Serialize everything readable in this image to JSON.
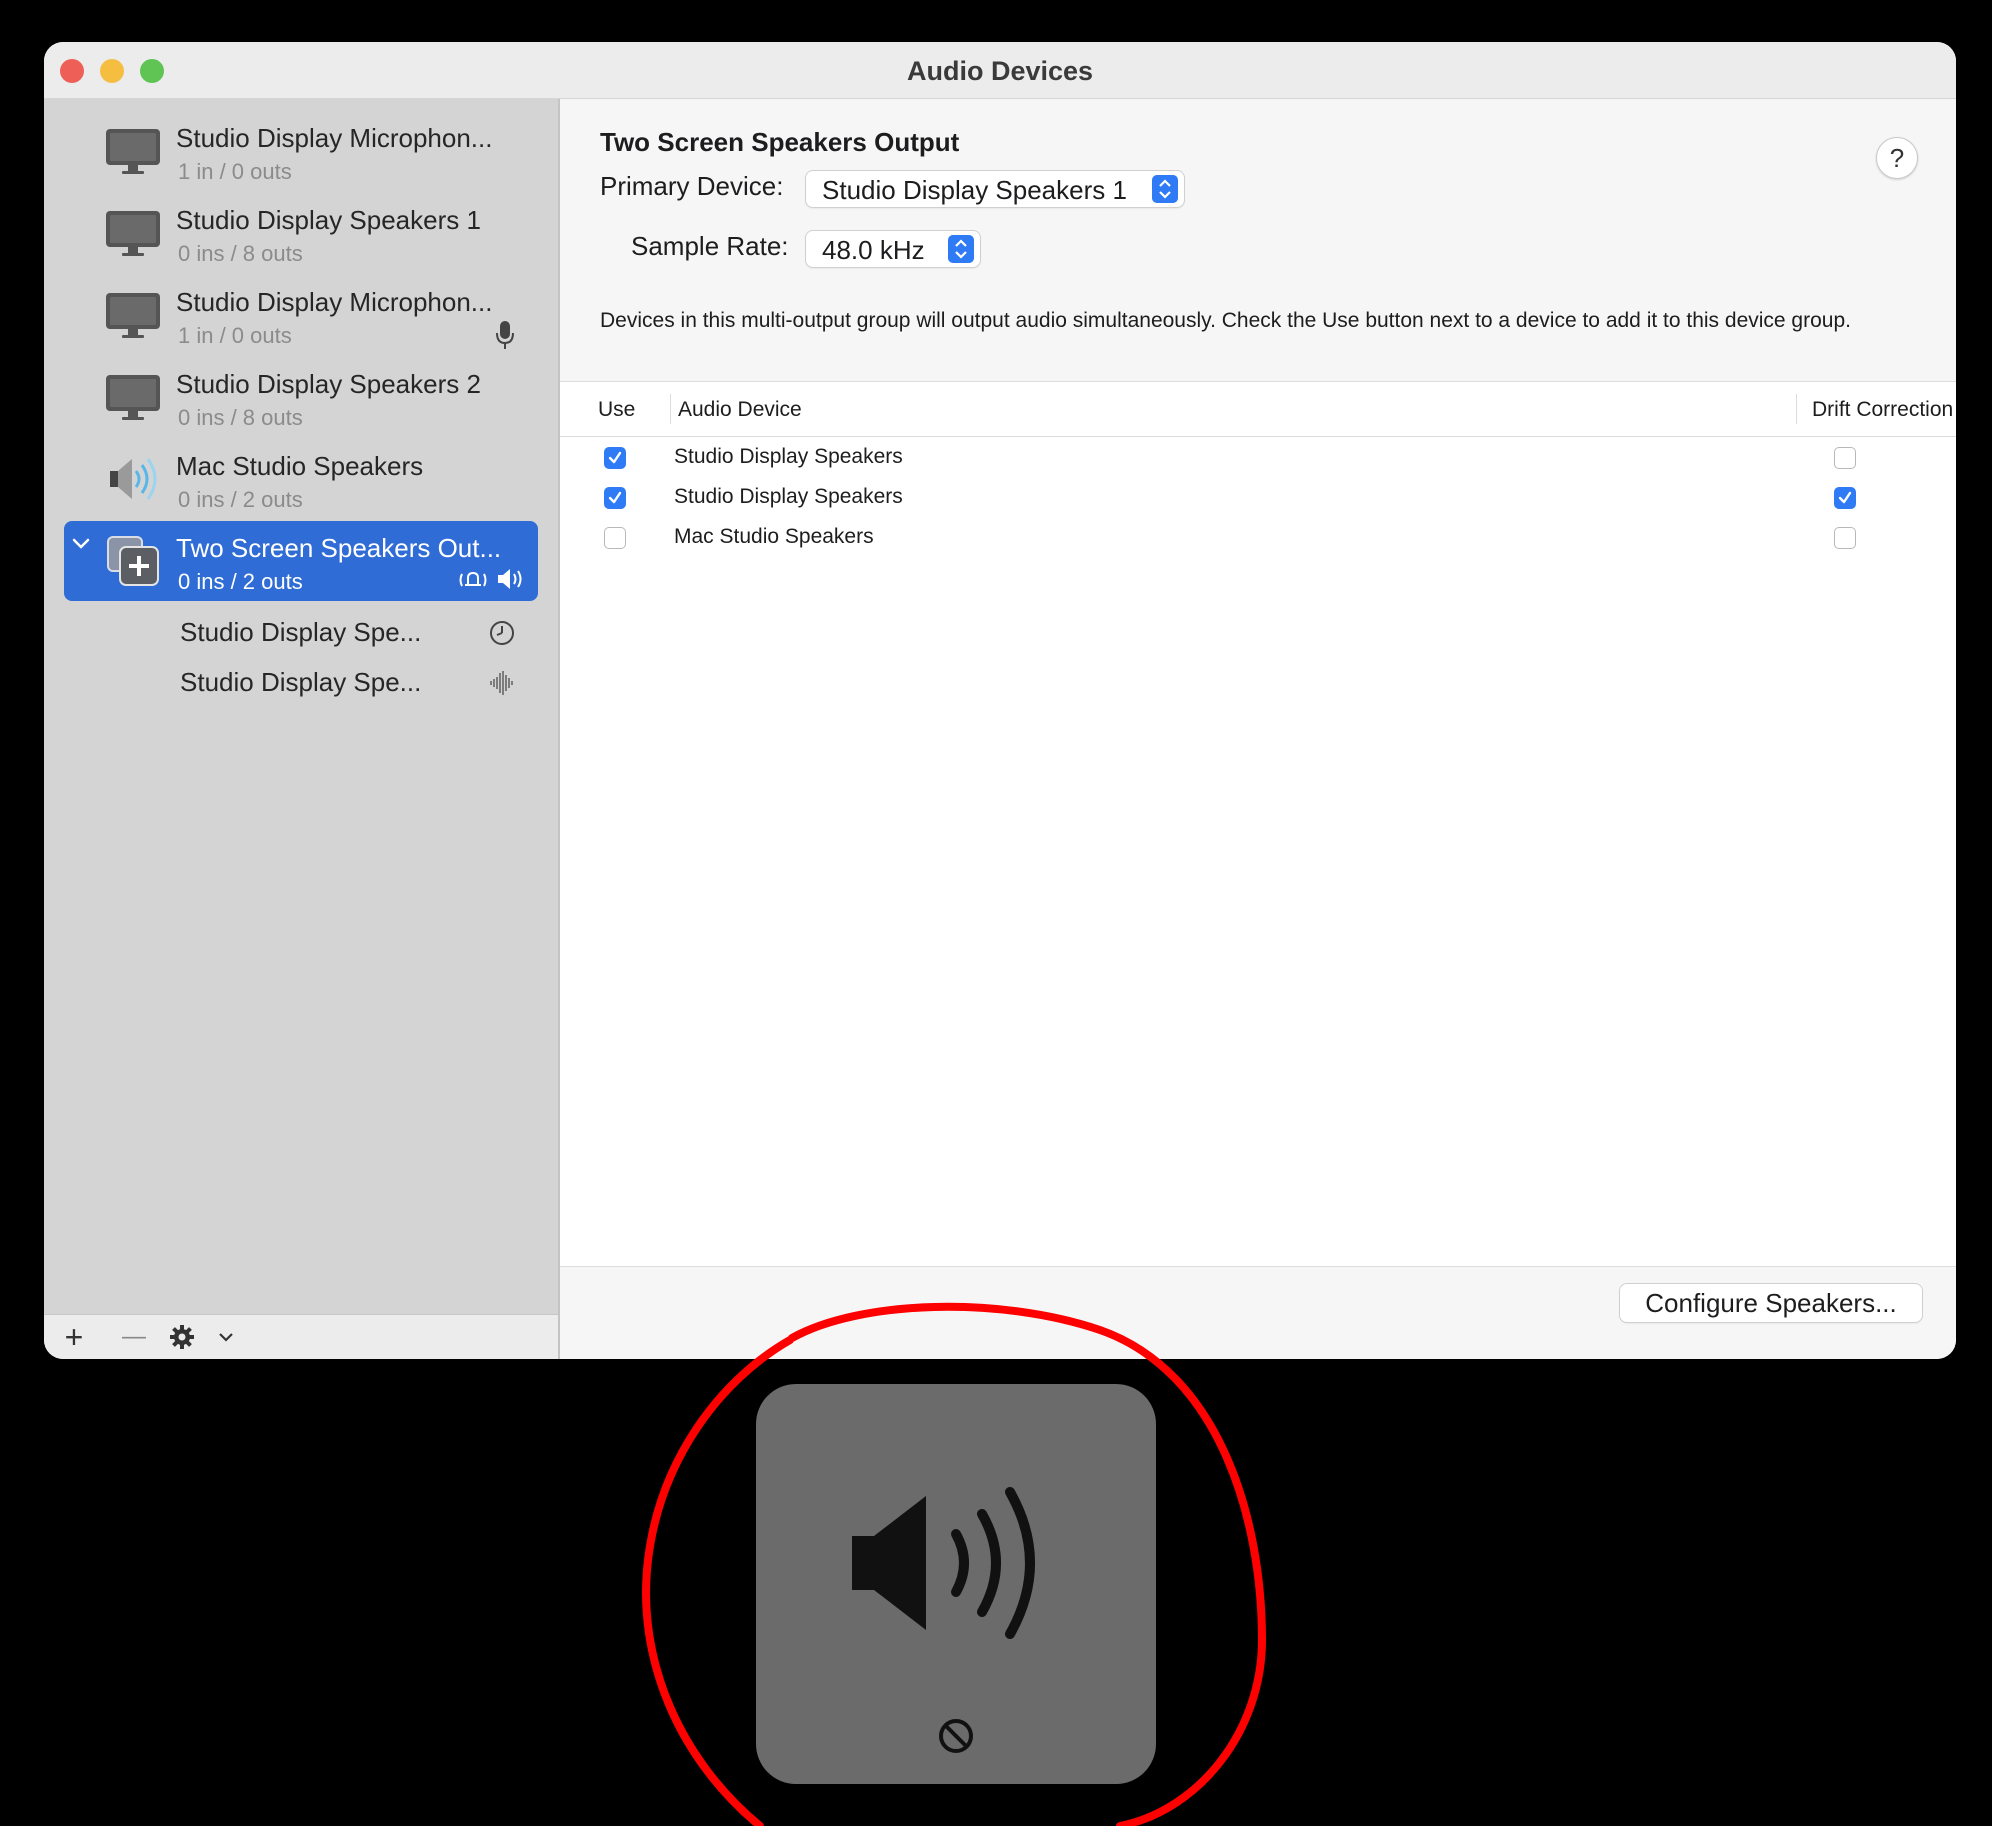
{
  "window": {
    "title": "Audio Devices"
  },
  "sidebar": {
    "devices": [
      {
        "name": "Studio Display Microphon...",
        "io": "1 in / 0 outs",
        "icon": "display-icon"
      },
      {
        "name": "Studio Display Speakers 1",
        "io": "0 ins / 8 outs",
        "icon": "display-icon"
      },
      {
        "name": "Studio Display Microphon...",
        "io": "1 in / 0 outs",
        "icon": "display-icon",
        "badge": "microphone-icon"
      },
      {
        "name": "Studio Display Speakers 2",
        "io": "0 ins / 8 outs",
        "icon": "display-icon"
      },
      {
        "name": "Mac Studio Speakers",
        "io": "0 ins / 2 outs",
        "icon": "speaker-device-icon"
      },
      {
        "name": "Two Screen Speakers Out...",
        "io": "0 ins / 2 outs",
        "icon": "multi-output-icon",
        "selected": true,
        "badges": [
          "alert-sound-icon",
          "speaker-output-icon"
        ]
      }
    ],
    "sub_devices": [
      {
        "name": "Studio Display Spe...",
        "icon": "clock-icon"
      },
      {
        "name": "Studio Display Spe...",
        "icon": "waveform-icon"
      }
    ],
    "footer": {
      "add": "+",
      "remove": "—"
    }
  },
  "main": {
    "title": "Two Screen Speakers Output",
    "help_label": "?",
    "primary_device_label": "Primary Device:",
    "primary_device_value": "Studio Display Speakers 1",
    "sample_rate_label": "Sample Rate:",
    "sample_rate_value": "48.0 kHz",
    "description": "Devices in this multi-output group will output audio simultaneously. Check the Use button next to a device to add it to this device group.",
    "table": {
      "headers": {
        "use": "Use",
        "device": "Audio Device",
        "drift": "Drift Correction"
      },
      "rows": [
        {
          "use": true,
          "device": "Studio Display Speakers",
          "drift": false
        },
        {
          "use": true,
          "device": "Studio Display Speakers",
          "drift": true
        },
        {
          "use": false,
          "device": "Mac Studio Speakers",
          "drift": false
        }
      ]
    },
    "configure_button": "Configure Speakers..."
  },
  "hud": {
    "icon": "volume-icon",
    "status_icon": "prohibited-icon"
  },
  "colors": {
    "accent": "#2f7bf5",
    "selection": "#2f6cd6",
    "annotation": "#ff0000"
  }
}
